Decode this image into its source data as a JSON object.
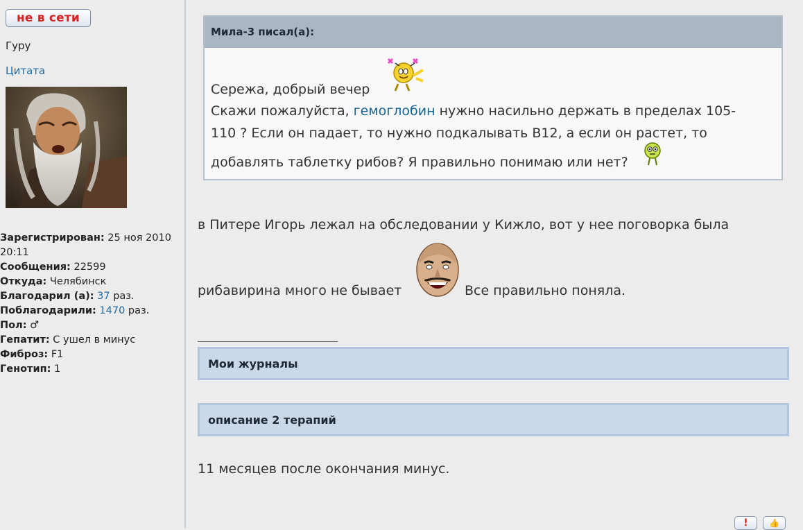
{
  "sidebar": {
    "status_button": "не в сети",
    "rank": "Гуру",
    "quote_link": "Цитата",
    "profile": {
      "registered_label": "Зарегистрирован:",
      "registered_value": " 25 ноя 2010 20:11",
      "posts_label": "Сообщения:",
      "posts_value": " 22599",
      "from_label": "Откуда:",
      "from_value": " Челябинск",
      "thanked_label": "Благодарил (а):",
      "thanked_count": "37",
      "thanked_suffix": " раз.",
      "thanked_by_label": "Поблагодарили:",
      "thanked_by_count": "1470",
      "thanked_by_suffix": " раз.",
      "gender_label": "Пол:",
      "gender_value": "♂",
      "hepatitis_label": "Гепатит:",
      "hepatitis_value": " С ушел в минус",
      "fibrosis_label": "Фиброз:",
      "fibrosis_value": " F1",
      "genotype_label": "Генотип:",
      "genotype_value": " 1"
    }
  },
  "quote": {
    "header": "Мила-3 писал(а):",
    "line1": "Сережа, добрый вечер",
    "line2_before": "Скажи пожалуйста, ",
    "line2_link": "гемоглобин",
    "line2_after": " нужно насильно держать в пределах 105-",
    "line3": "110 ? Если он падает, то нужно подкалывать В12, а если он растет, то",
    "line4": "добавлять таблетку рибов? Я правильно понимаю или нет?"
  },
  "post": {
    "line1": "в Питере Игорь лежал на обследовании у Кижло, вот у нее поговорка была",
    "line2_before": "рибавирина много не бывает",
    "line2_after": "Все правильно поняла.",
    "sig_box1": "Мои журналы",
    "sig_box2": "описание 2 терапий",
    "sig_text": "11 месяцев после окончания минус."
  },
  "icons": {
    "report": "!",
    "thanks": "👍"
  },
  "colors": {
    "status_red": "#d22626",
    "link_blue": "#1f6aa3",
    "quote_header": "#a9b6c4",
    "sig_box": "#c9d9ea"
  }
}
